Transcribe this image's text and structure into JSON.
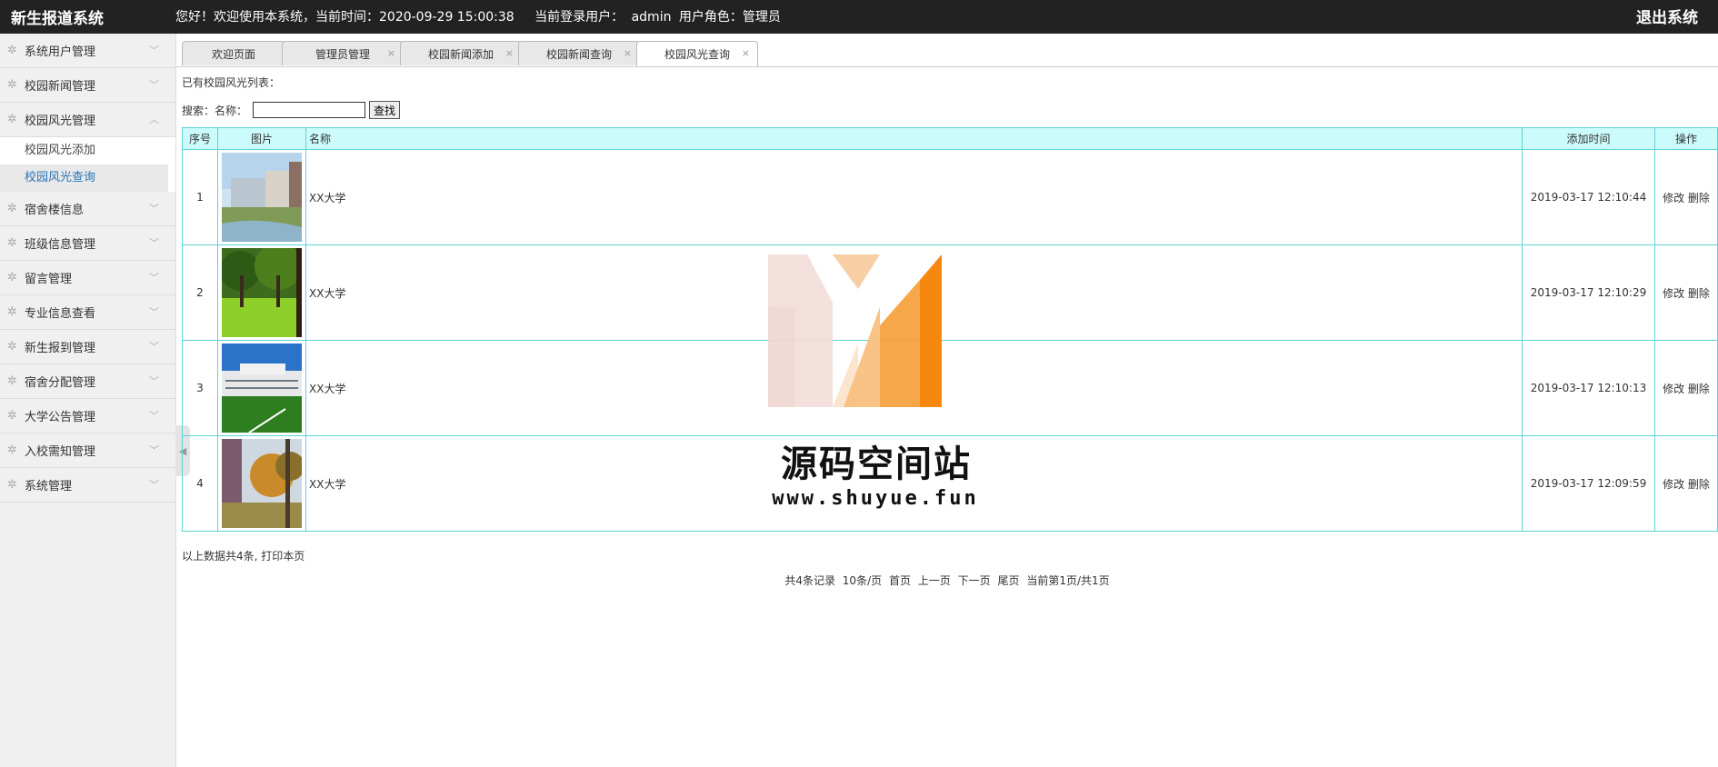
{
  "app": {
    "title": "新生报道系统",
    "welcome": "您好！欢迎使用本系统，当前时间：2020-09-29 15:00:38",
    "user_label": "当前登录用户：",
    "user": "admin",
    "role_label": "用户角色：管理员",
    "logout": "退出系统"
  },
  "sidebar": {
    "items": [
      {
        "label": "系统用户管理"
      },
      {
        "label": "校园新闻管理"
      },
      {
        "label": "校园风光管理"
      },
      {
        "label": "宿舍楼信息"
      },
      {
        "label": "班级信息管理"
      },
      {
        "label": "留言管理"
      },
      {
        "label": "专业信息查看"
      },
      {
        "label": "新生报到管理"
      },
      {
        "label": "宿舍分配管理"
      },
      {
        "label": "大学公告管理"
      },
      {
        "label": "入校需知管理"
      },
      {
        "label": "系统管理"
      }
    ],
    "submenu": [
      "校园风光添加",
      "校园风光查询"
    ]
  },
  "tabs": [
    "欢迎页面",
    "管理员管理",
    "校园新闻添加",
    "校园新闻查询",
    "校园风光查询"
  ],
  "page": {
    "list_title": "已有校园风光列表：",
    "search_label": "搜索：",
    "name_label": "名称：",
    "search_value": "",
    "search_button": "查找"
  },
  "table": {
    "headers": [
      "序号",
      "图片",
      "名称",
      "添加时间",
      "操作"
    ],
    "rows": [
      {
        "num": "1",
        "name": "XX大学",
        "time": "2019-03-17 12:10:44"
      },
      {
        "num": "2",
        "name": "XX大学",
        "time": "2019-03-17 12:10:29"
      },
      {
        "num": "3",
        "name": "XX大学",
        "time": "2019-03-17 12:10:13"
      },
      {
        "num": "4",
        "name": "XX大学",
        "time": "2019-03-17 12:09:59"
      }
    ],
    "edit": "修改",
    "delete": "删除"
  },
  "footer": {
    "summary_prefix": "以上数据共4条,",
    "print": "打印本页",
    "records": "共4条记录",
    "per_page": "10条/页",
    "first": "首页",
    "prev": "上一页",
    "next": "下一页",
    "last": "尾页",
    "current": "当前第1页/共1页"
  },
  "watermark": {
    "text": "源码空间站",
    "url": "www.shuyue.fun"
  },
  "colors": {
    "topbar": "#222222",
    "table_border": "#5fd3d3",
    "table_header": "#ccfbfb",
    "active_link": "#2a76b8",
    "watermark_orange": "#f7880f"
  }
}
